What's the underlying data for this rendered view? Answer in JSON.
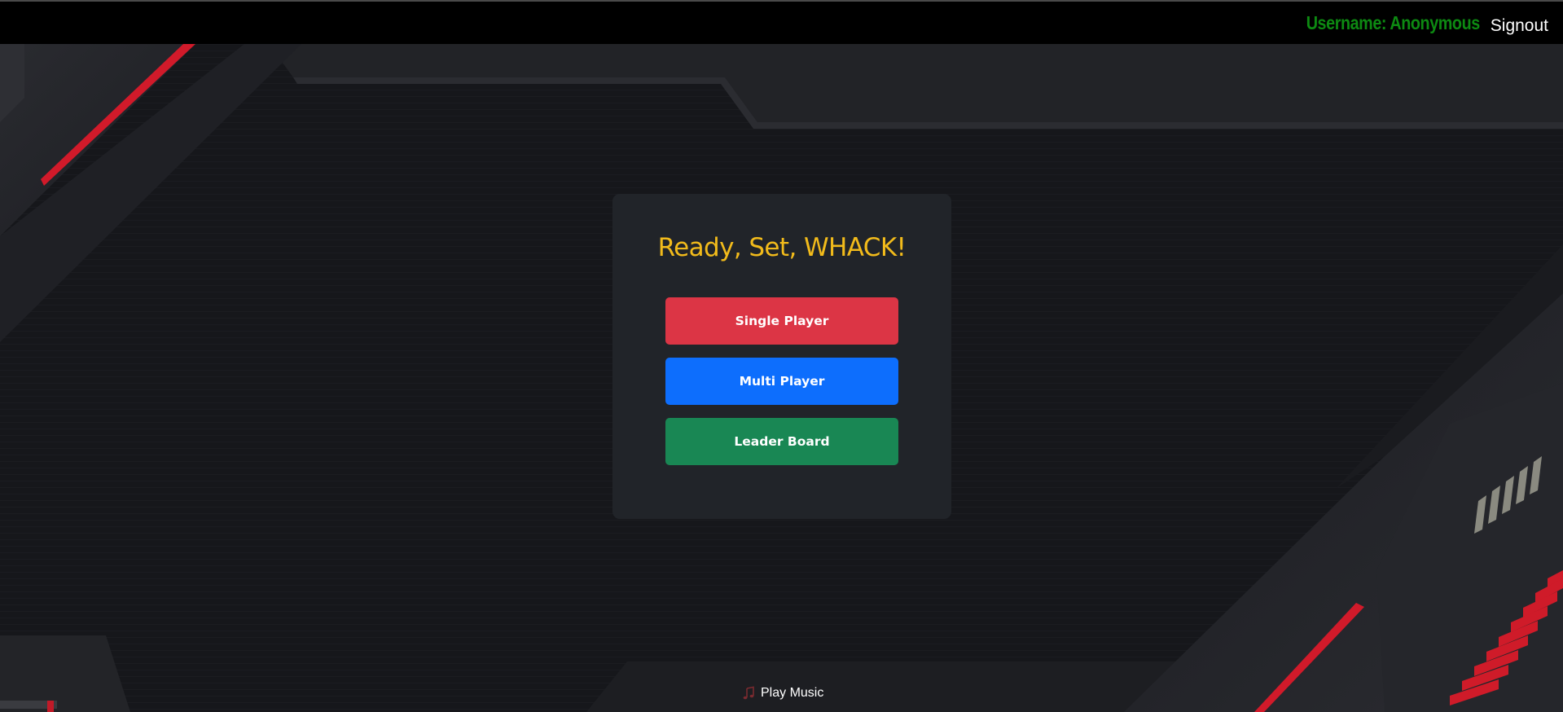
{
  "header": {
    "username_text": "Username: Anonymous",
    "signout_label": "Signout"
  },
  "menu": {
    "title": "Ready, Set, WHACK!",
    "buttons": [
      {
        "label": "Single Player",
        "color": "#dc3545"
      },
      {
        "label": "Multi Player",
        "color": "#0d6efd"
      },
      {
        "label": "Leader Board",
        "color": "#198754"
      }
    ]
  },
  "music": {
    "icon": "music-note-icon",
    "label": "Play Music"
  },
  "colors": {
    "username": "#0d8a12",
    "title": "#f2bb1b",
    "card": "#212429",
    "accent_red": "#e0202e"
  }
}
